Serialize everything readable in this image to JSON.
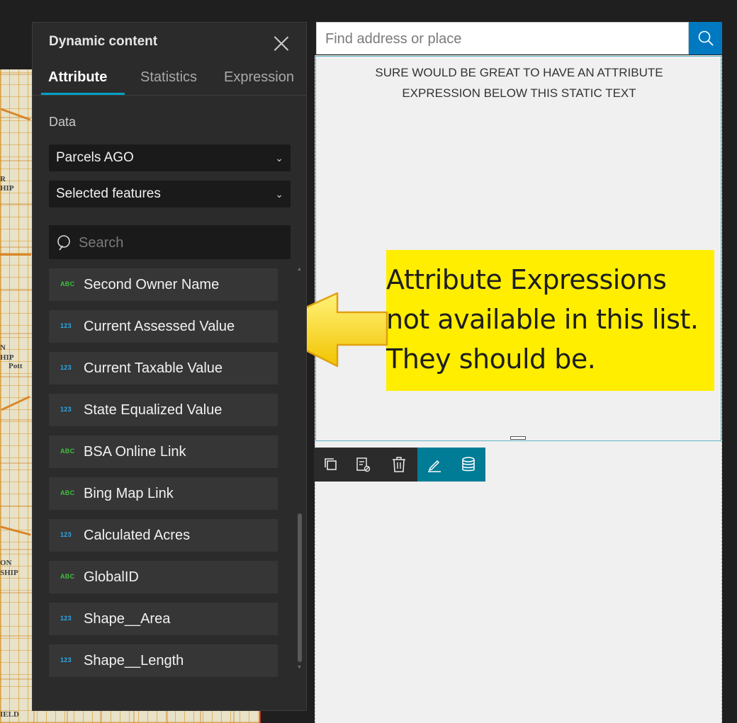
{
  "panel": {
    "title": "Dynamic content",
    "tabs": [
      {
        "label": "Attribute",
        "active": true
      },
      {
        "label": "Statistics",
        "active": false
      },
      {
        "label": "Expression",
        "active": false
      }
    ],
    "data_label": "Data",
    "layer_select": {
      "value": "Parcels AGO",
      "icon": "chevron-down-icon"
    },
    "features_select": {
      "value": "Selected features",
      "icon": "chevron-down-icon"
    },
    "search": {
      "placeholder": "Search",
      "value": ""
    },
    "fields": [
      {
        "type": "ABC",
        "name": "Second Owner Name"
      },
      {
        "type": "123",
        "name": "Current Assessed Value"
      },
      {
        "type": "123",
        "name": "Current Taxable Value"
      },
      {
        "type": "123",
        "name": "State Equalized Value"
      },
      {
        "type": "ABC",
        "name": "BSA Online Link"
      },
      {
        "type": "ABC",
        "name": "Bing Map Link"
      },
      {
        "type": "123",
        "name": "Calculated Acres"
      },
      {
        "type": "ABC",
        "name": "GlobalID"
      },
      {
        "type": "123",
        "name": "Shape__Area"
      },
      {
        "type": "123",
        "name": "Shape__Length"
      }
    ]
  },
  "search_bar": {
    "placeholder": "Find address or place",
    "value": ""
  },
  "text_widget": {
    "static_text": "SURE WOULD BE GREAT TO HAVE AN ATTRIBUTE EXPRESSION BELOW THIS STATIC TEXT"
  },
  "callout": {
    "lines": [
      "Attribute Expressions",
      "not available in this list.",
      "They should be."
    ],
    "color": "#ffee00"
  },
  "toolbar": {
    "tools": [
      "duplicate-icon",
      "clear-format-icon",
      "trash-icon",
      "edit-icon",
      "database-icon"
    ]
  },
  "map": {
    "labels": [
      "R",
      "HIP",
      "N",
      "HIP",
      "Pott",
      "ON",
      "SHIP",
      "IELD"
    ]
  },
  "colors": {
    "accent": "#00a0c6",
    "search_button": "#0079c1",
    "tool_active": "#007c96",
    "type_abc": "#3ebf3e",
    "type_number": "#2ea8e6"
  }
}
